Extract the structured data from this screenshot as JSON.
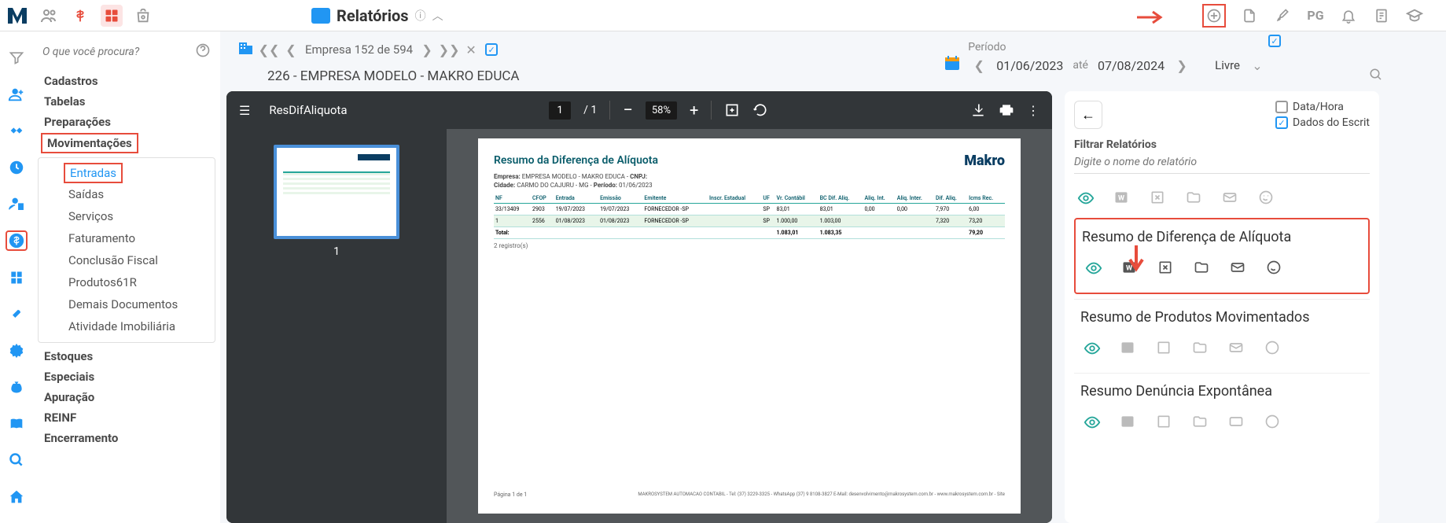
{
  "header": {
    "page_title": "Relatórios"
  },
  "search": {
    "placeholder": "O que você procura?"
  },
  "menu": {
    "items": [
      "Cadastros",
      "Tabelas",
      "Preparações",
      "Movimentações",
      "Estoques",
      "Especiais",
      "Apuração",
      "REINF",
      "Encerramento"
    ],
    "submenu": [
      "Entradas",
      "Saídas",
      "Serviços",
      "Faturamento",
      "Conclusão Fiscal",
      "Produtos61R",
      "Demais Documentos",
      "Atividade Imobiliária"
    ]
  },
  "company_nav": {
    "counter": "Empresa 152 de 594",
    "name": "226 - EMPRESA MODELO - MAKRO EDUCA"
  },
  "period": {
    "label": "Período",
    "from": "01/06/2023",
    "to_label": "até",
    "to": "07/08/2024",
    "mode": "Livre"
  },
  "pdf": {
    "filename": "ResDifAliquota",
    "page": "1",
    "pages": "1",
    "zoom": "58%",
    "thumb_label": "1"
  },
  "document": {
    "title": "Resumo da Diferença de Alíquota",
    "logo": "Makro",
    "line1_label_empresa": "Empresa:",
    "line1_empresa": "EMPRESA MODELO - MAKRO EDUCA",
    "line1_label_cnpj": "CNPJ:",
    "line2_label_cidade": "Cidade:",
    "line2_cidade": "CARMO DO CAJURU - MG",
    "line2_label_periodo": "Período:",
    "line2_periodo": "01/06/2023",
    "headers": [
      "NF",
      "CFOP",
      "Entrada",
      "Emissão",
      "Emitente",
      "Inscr. Estadual",
      "UF",
      "Vr. Contábil",
      "BC Dif. Aliq.",
      "Aliq. Int.",
      "Aliq. Inter.",
      "Dif. Aliq.",
      "Icms Rec."
    ],
    "rows": [
      [
        "33/13409",
        "2903",
        "19/07/2023",
        "19/07/2023",
        "FORNECEDOR -SP",
        "",
        "SP",
        "83,01",
        "83,01",
        "0,00",
        "0,00",
        "7,970",
        "6,00"
      ],
      [
        "1",
        "2556",
        "01/08/2023",
        "01/08/2023",
        "FORNECEDOR -SP",
        "",
        "SP",
        "1.000,00",
        "1.003,00",
        "",
        "",
        "7,320",
        "73,20"
      ]
    ],
    "total_label": "Total:",
    "totals": [
      "1.083,01",
      "1.083,35",
      "",
      "",
      "",
      "79,20"
    ],
    "records": "2 registro(s)",
    "footer_page": "Página 1 de 1",
    "footer_info": "MAKROSYSTEM AUTOMACAO CONTABIL - Tel: (37) 3229-3325 - WhatsApp (37) 9 8108-3827   E-Mail: desenvolvimento@makrosystem.com.br - www.makrosystem.com.br - Site"
  },
  "right_panel": {
    "option1": "Data/Hora",
    "option2": "Dados do Escrit",
    "filter_label": "Filtrar Relatórios",
    "filter_placeholder": "Digite o nome do relatório",
    "reports": [
      "Resumo de Diferença de Alíquota",
      "Resumo de Produtos Movimentados",
      "Resumo Denúncia Expontânea"
    ]
  }
}
